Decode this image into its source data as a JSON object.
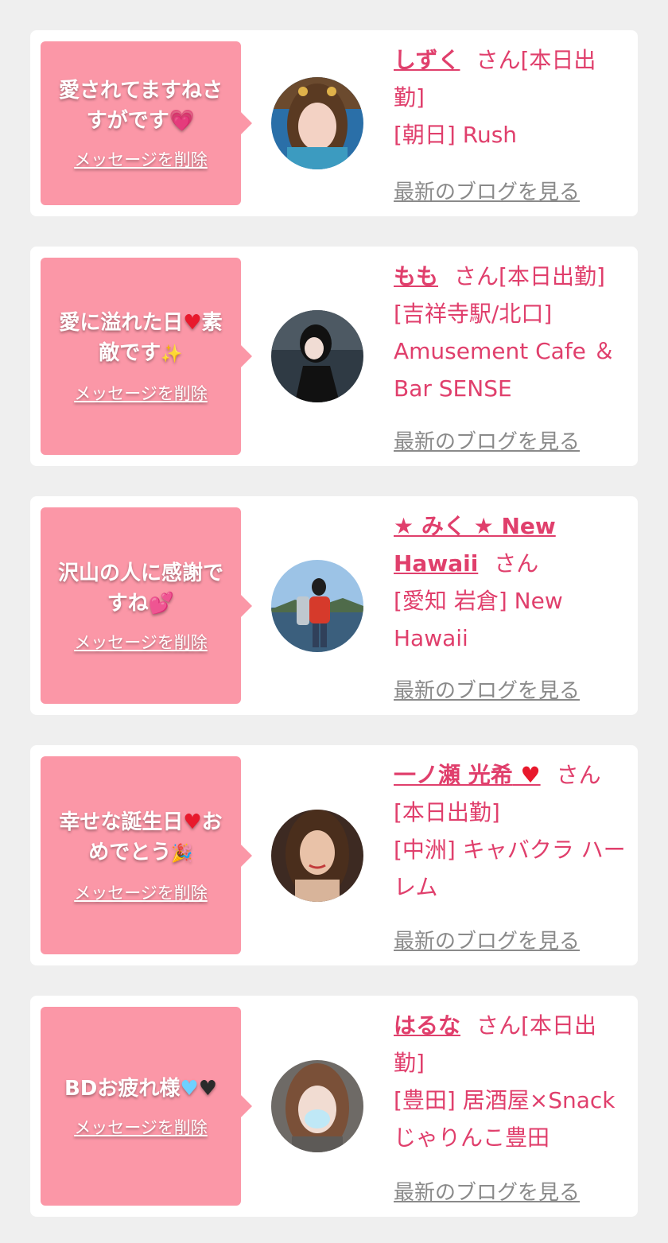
{
  "delete_label": "メッセージを削除",
  "blog_label": "最新のブログを見る",
  "cards": [
    {
      "message": "愛されてますねさすがです",
      "message_emoji": "💗",
      "name": "しずく",
      "honorific": "さん",
      "status": "[本日出勤]",
      "shop": "[朝日] Rush"
    },
    {
      "message_a": "愛に溢れた日",
      "message_emoji_a": "♥",
      "message_b": "素敵です",
      "message_emoji_b": "✨",
      "name": "もも",
      "honorific": "さん",
      "status": "[本日出勤]",
      "shop": "[吉祥寺駅/北口] Amusement Cafe ＆Bar SENSE"
    },
    {
      "message": "沢山の人に感謝ですね",
      "message_emoji": "💕",
      "name": "★ みく ★ New Hawaii",
      "honorific": "さん",
      "status": "",
      "shop": "[愛知 岩倉] New Hawaii"
    },
    {
      "message_a": "幸せな誕生日",
      "message_emoji_a": "♥",
      "message_b": "おめでとう",
      "message_emoji_b": "🎉",
      "name": "一ノ瀬 光希",
      "name_emoji": "♥",
      "honorific": "さん",
      "status": "[本日出勤]",
      "shop": "[中洲] キャバクラ ハーレム"
    },
    {
      "message": "BDお疲れ様",
      "message_emoji_a": "♥",
      "message_emoji_b": "♥",
      "name": "はるな",
      "honorific": "さん",
      "status": "[本日出勤]",
      "shop": "[豊田] 居酒屋×Snack じゃりんこ豊田"
    }
  ],
  "colors": {
    "background": "#efefef",
    "card": "#ffffff",
    "bubble": "#fb97a7",
    "accent": "#e03f6c",
    "link_gray": "#8a8a8a"
  }
}
